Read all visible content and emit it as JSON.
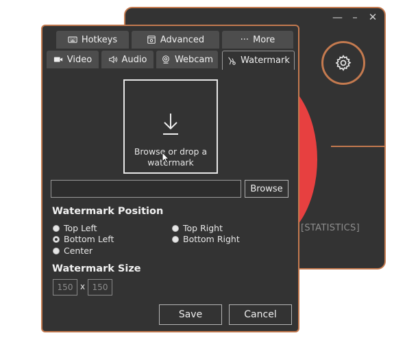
{
  "main_window": {
    "title_buttons": [
      "—",
      "–",
      "✕"
    ],
    "statistics_label": "[STATISTICS]",
    "accent_color": "#c47a4f",
    "record_color": "#e74040"
  },
  "settings": {
    "tabs_top": [
      {
        "label": "Hotkeys",
        "icon": "keyboard-icon"
      },
      {
        "label": "Advanced",
        "icon": "advanced-icon"
      },
      {
        "label": "More",
        "icon": "ellipsis-icon",
        "prefix": "···"
      }
    ],
    "tabs_bottom": [
      {
        "label": "Video",
        "icon": "video-camera-icon"
      },
      {
        "label": "Audio",
        "icon": "speaker-icon"
      },
      {
        "label": "Webcam",
        "icon": "webcam-icon"
      },
      {
        "label": "Watermark",
        "icon": "watermark-icon",
        "active": true
      }
    ],
    "drop_zone": {
      "text": "Browse or drop a watermark",
      "icon": "download-arrow-icon"
    },
    "path_value": "",
    "browse_label": "Browse",
    "position": {
      "title": "Watermark Position",
      "options": [
        "Top Left",
        "Bottom Left",
        "Center",
        "Top Right",
        "Bottom Right"
      ],
      "selected": "Bottom Left"
    },
    "size": {
      "title": "Watermark Size",
      "width": "150",
      "height": "150",
      "separator": "x"
    },
    "save_label": "Save",
    "cancel_label": "Cancel"
  }
}
